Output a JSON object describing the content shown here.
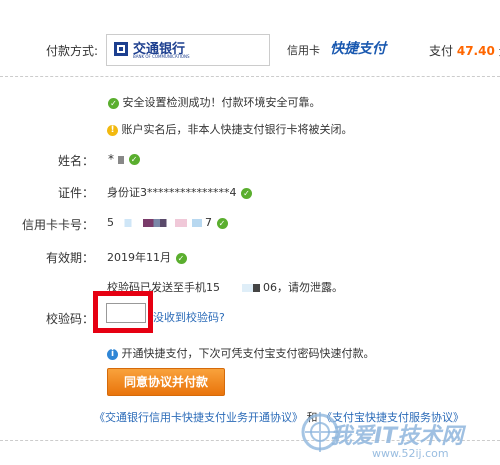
{
  "payment": {
    "method_label": "付款方式:",
    "bank_name": "交通银行",
    "bank_name_en": "BANK OF COMMUNICATIONS",
    "card_type": "信用卡",
    "quick_pay_logo": "快捷支付",
    "pay_prefix": "支付",
    "amount": "47.40",
    "currency_unit": "元"
  },
  "notices": {
    "security_ok": "安全设置检测成功！付款环境安全可靠。",
    "realname_warning": "账户实名后，非本人快捷支付银行卡将被关闭。"
  },
  "fields": {
    "name_label": "姓名：",
    "name_value": "*",
    "id_label": "证件：",
    "id_value": "身份证3***************4",
    "card_label": "信用卡卡号：",
    "card_prefix": "5",
    "card_suffix": "7",
    "expiry_label": "有效期：",
    "expiry_value": "2019年11月"
  },
  "sms": {
    "sent_text_prefix": "校验码已发送至手机15",
    "sent_text_suffix": "06，请勿泄露。",
    "code_label": "校验码：",
    "code_placeholder": "",
    "not_received_link": "没收到校验码?"
  },
  "info_note": "开通快捷支付，下次可凭支付宝支付密码快速付款。",
  "submit_button": "同意协议并付款",
  "agreements": {
    "agreement1": "《交通银行信用卡快捷支付业务开通协议》",
    "and": "和",
    "agreement2": "《支付宝快捷支付服务协议》"
  },
  "watermark": {
    "text": "我爱IT技术网",
    "url": "www.52ij.com"
  },
  "colors": {
    "amount": "#ff6600",
    "highlight_box": "#e60012",
    "button": "#f08a1e",
    "check": "#5aae2e",
    "link": "#2b6bb8"
  }
}
